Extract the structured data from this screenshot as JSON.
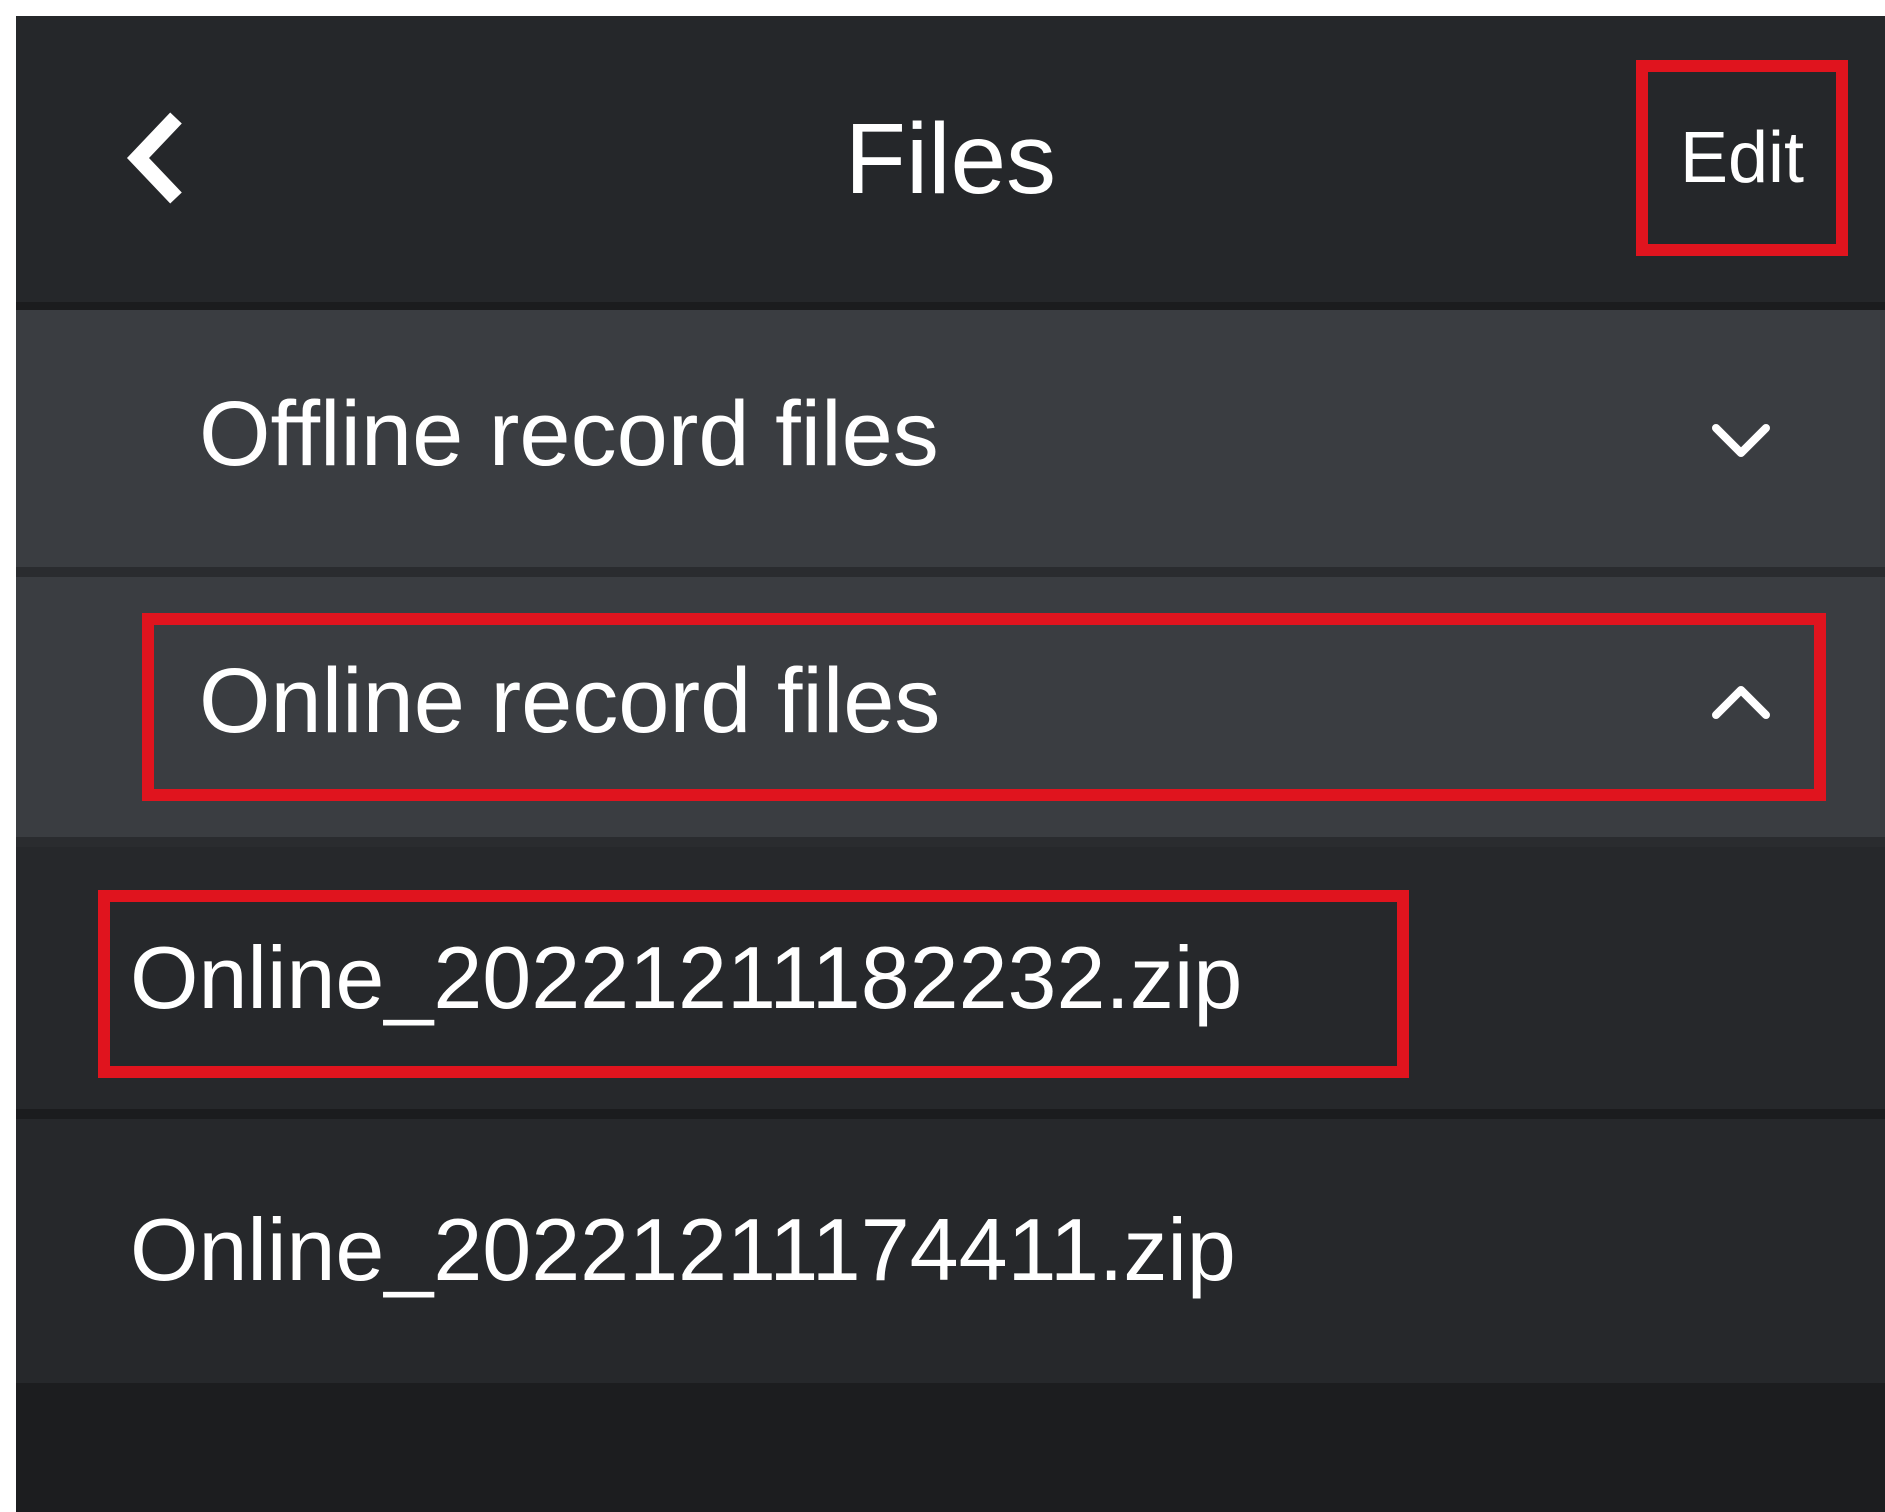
{
  "header": {
    "title": "Files",
    "edit_label": "Edit",
    "back_icon": "chevron-left-icon"
  },
  "sections": [
    {
      "label": "Offline record files",
      "state": "collapsed",
      "icon": "chevron-down-icon"
    },
    {
      "label": "Online record files",
      "state": "expanded",
      "icon": "chevron-up-icon"
    }
  ],
  "files": [
    {
      "name": "Online_20221211182232.zip"
    },
    {
      "name": "Online_20221211174411.zip"
    }
  ],
  "colors": {
    "background": "#1c1d1f",
    "header": "#25272a",
    "section_row": "#3a3d41",
    "file_row": "#26282b",
    "text": "#ffffff",
    "highlight": "#e0141e"
  }
}
